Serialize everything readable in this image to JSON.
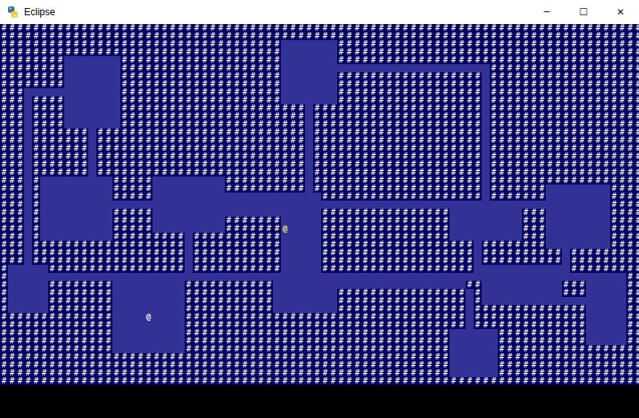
{
  "window": {
    "title": "Eclipse",
    "controls": [
      "─",
      "☐",
      "✕"
    ]
  },
  "map": {
    "wall_glyph": "#",
    "rows": [
      "################################################################################",
      "################################################################################",
      "###################################       ######################################",
      "###################################       ######################################",
      "########       ####################       ######################################",
      "########       ####################                          ###################",
      "########       ####################       ################## ###################",
      "########       ####################       ################## ###################",
      "###            ####################       ################## ###################",
      "### ####       ####################       ################## ###################",
      "### ####       ####################### ##################### ###################",
      "### ####       ####################### ##################### ###################",
      "### ####       ####################### ##################### ###################",
      "### ####### ########################## ##################### ###################",
      "### ####### ########################## ##################### ###################",
      "### ####### ########################## ##################### ###################",
      "### ####### ########################## ##################### ###################",
      "### ####### ########################## ##################### ###################",
      "### ####### ########################## ##################### ###################",
      "### #         #####         ########## ##################### ###################",
      "### #         #####         ########## ##################### #######        ####",
      "### #         #####                     #################### #######        ####",
      "### #                                                                       ####",
      "### #         #####                     ################         ###        ####",
      "### #         #####         #######     ################         ###        ####",
      "### #         #####         #######@    ################         ###        ####",
      "### #         ######### ###########     ################         ###        ####",
      "### ################### ###########     ################### ########        ####",
      "### ################### ###########     ################### ########## #########",
      "### ################### ###########     ################### ########## #########",
      "#     ################# ###########     ###################            #########",
      "#                                                                             ##",
      "#     ########         ###########                        ##          ###     ##",
      "#     ########         ###########        ################ #          ###     ##",
      "#     ########         ###########        ################ #                  ##",
      "#     ########         ###########        ################ ##############     ##",
      "##############    @    ################################### ##############     ##",
      "##############         ################################### ##############     ##",
      "##############         #################################      ###########     ##",
      "##############         #################################      ###########     ##",
      "##############         #################################      ##################",
      "########################################################      ##################",
      "########################################################      ##################",
      "########################################################      ##################",
      "################################################################################"
    ]
  },
  "actors": [
    {
      "glyph": "@",
      "color": "#f2e45c"
    },
    {
      "glyph": "@",
      "color": "#e6e6e6"
    }
  ]
}
